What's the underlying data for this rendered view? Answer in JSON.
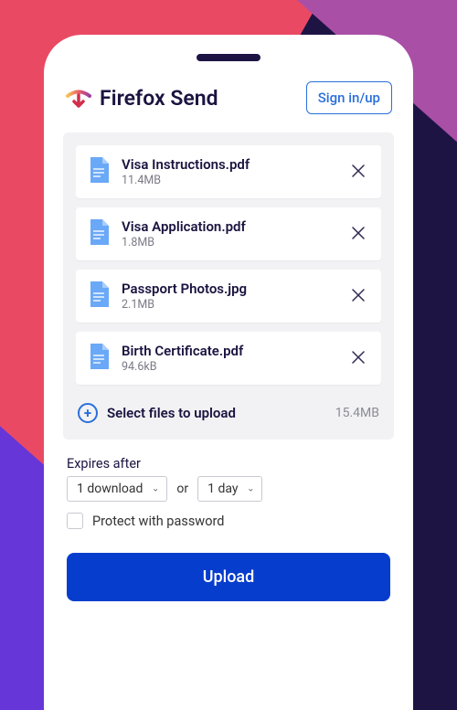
{
  "header": {
    "brand": "Firefox Send",
    "sign_in": "Sign in/up"
  },
  "files": [
    {
      "name": "Visa Instructions.pdf",
      "size": "11.4MB"
    },
    {
      "name": "Visa Application.pdf",
      "size": "1.8MB"
    },
    {
      "name": "Passport Photos.jpg",
      "size": "2.1MB"
    },
    {
      "name": "Birth Certificate.pdf",
      "size": "94.6kB"
    }
  ],
  "select": {
    "label": "Select files to upload",
    "total": "15.4MB"
  },
  "expiry": {
    "title": "Expires after",
    "downloads": "1 download",
    "or": "or",
    "time": "1 day"
  },
  "protect": {
    "label": "Protect with password"
  },
  "upload": {
    "label": "Upload"
  }
}
